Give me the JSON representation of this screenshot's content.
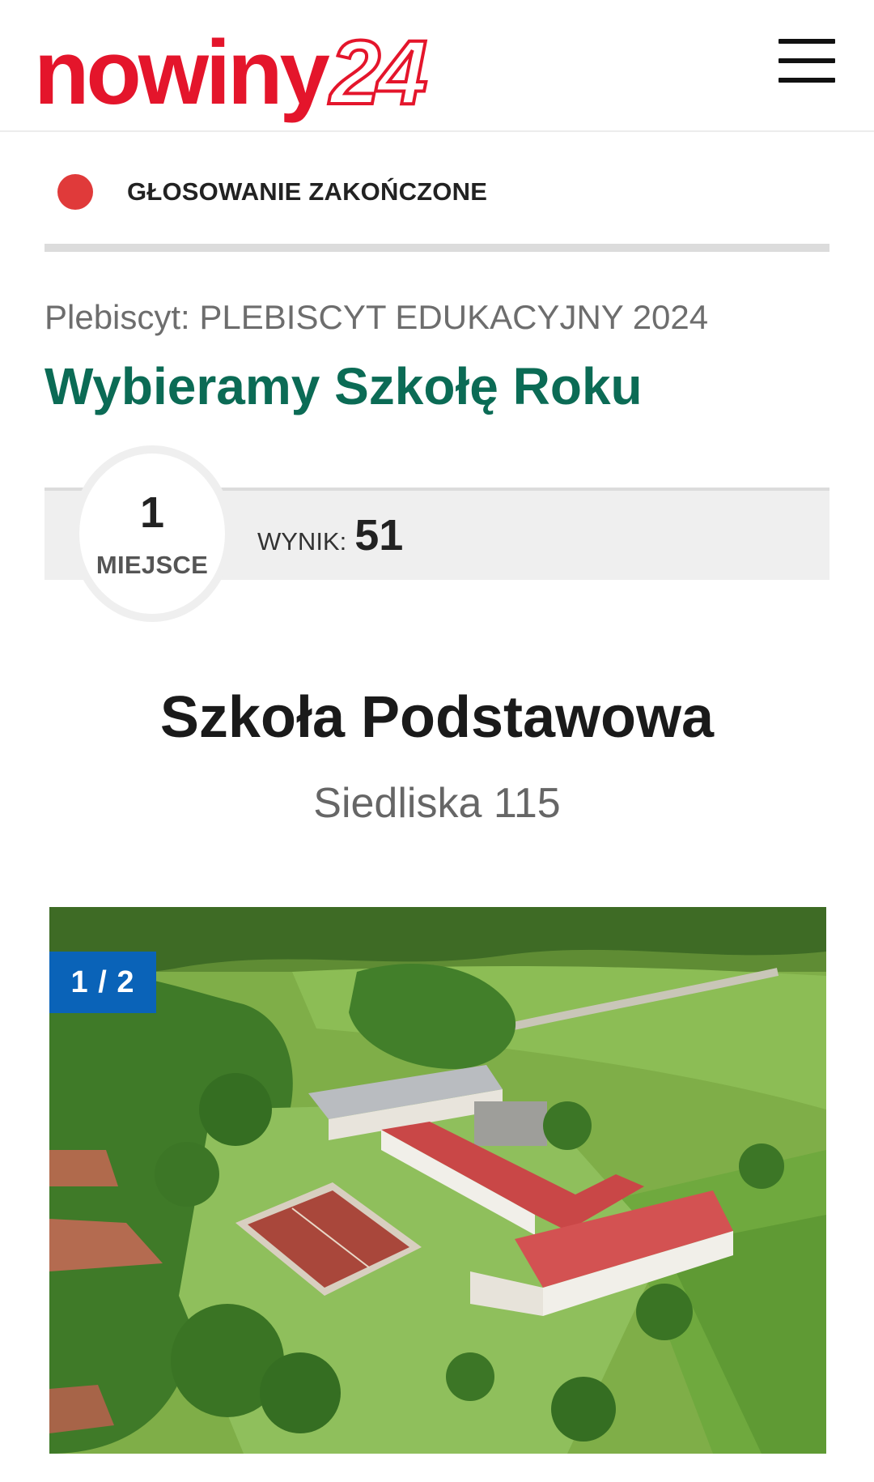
{
  "header": {
    "logo_word": "nowiny",
    "logo_number": "24"
  },
  "voting": {
    "status": "GŁOSOWANIE ZAKOŃCZONE",
    "status_color": "#e03a3a"
  },
  "plebiscite": {
    "line": "Plebiscyt: PLEBISCYT EDUKACYJNY 2024",
    "category": "Wybieramy Szkołę Roku",
    "category_color": "#0b6b55"
  },
  "ranking": {
    "place": "1",
    "place_label": "MIEJSCE",
    "score_label": "WYNIK:",
    "score_value": "51"
  },
  "school": {
    "name": "Szkoła Podstawowa",
    "address": "Siedliska 115"
  },
  "gallery": {
    "counter": "1 / 2",
    "accent_color": "#0a63b8"
  }
}
